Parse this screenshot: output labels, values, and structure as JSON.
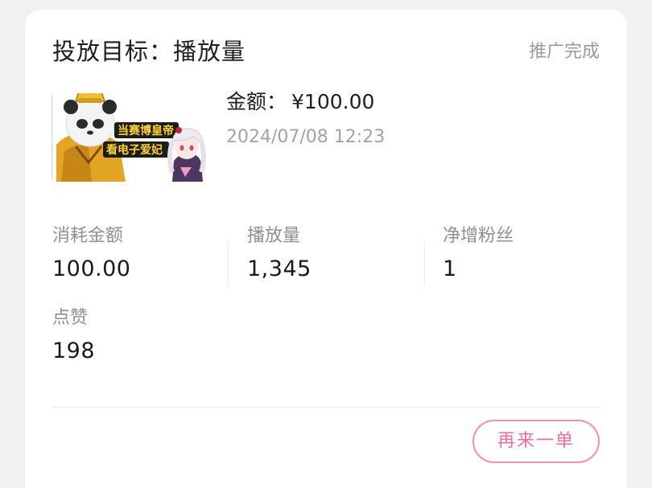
{
  "order": {
    "title": "投放目标：播放量",
    "status": "推广完成",
    "amount_label": "金额：",
    "amount_value": "¥100.00",
    "datetime": "2024/07/08 12:23",
    "thumbnail": {
      "caption_line1": "当赛博皇帝",
      "caption_line2": "看电子爱妃"
    }
  },
  "stats": [
    {
      "label": "消耗金额",
      "value": "100.00"
    },
    {
      "label": "播放量",
      "value": "1,345"
    },
    {
      "label": "净增粉丝",
      "value": "1"
    },
    {
      "label": "点赞",
      "value": "198"
    }
  ],
  "actions": {
    "reorder_label": "再来一单"
  },
  "colors": {
    "accent": "#ee6f9a",
    "background": "#f1f1f3",
    "card": "#ffffff"
  }
}
